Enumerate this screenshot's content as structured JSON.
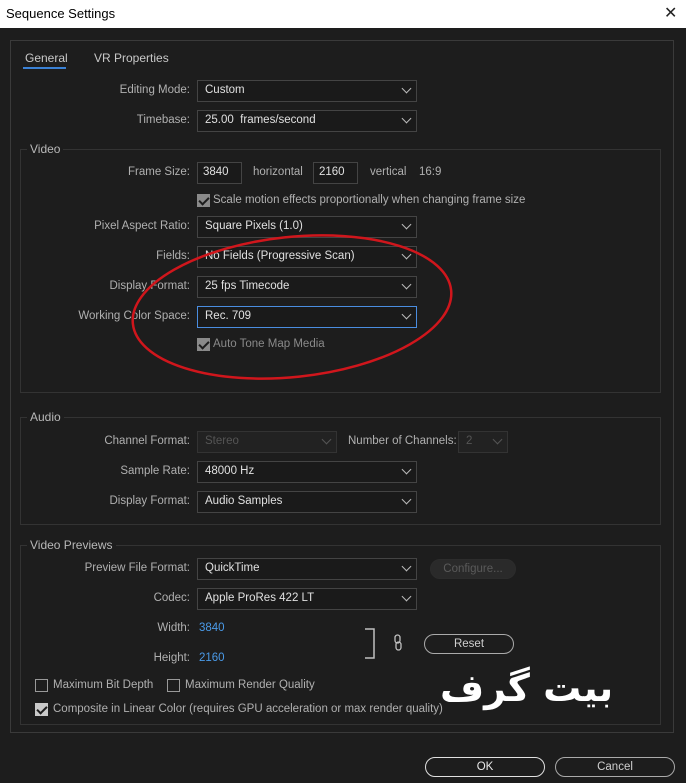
{
  "window": {
    "title": "Sequence Settings",
    "close_glyph": "✕"
  },
  "tabs": [
    "General",
    "VR Properties"
  ],
  "general": {
    "editing_mode": {
      "label": "Editing Mode:",
      "value": "Custom"
    },
    "timebase": {
      "label": "Timebase:",
      "value": "25.00  frames/second"
    }
  },
  "video": {
    "title": "Video",
    "frame_size_label": "Frame Size:",
    "width": "3840",
    "horizontal_label": "horizontal",
    "height": "2160",
    "vertical_label": "vertical",
    "aspect": "16:9",
    "scale_motion_label": "Scale motion effects proportionally when changing frame size",
    "pixel_aspect": {
      "label": "Pixel Aspect Ratio:",
      "value": "Square Pixels (1.0)"
    },
    "fields": {
      "label": "Fields:",
      "value": "No Fields (Progressive Scan)"
    },
    "display_format": {
      "label": "Display Format:",
      "value": "25 fps Timecode"
    },
    "color_space": {
      "label": "Working Color Space:",
      "value": "Rec. 709"
    },
    "auto_tone_map_label": "Auto Tone Map Media"
  },
  "audio": {
    "title": "Audio",
    "channel_format": {
      "label": "Channel Format:",
      "value": "Stereo"
    },
    "num_channels": {
      "label": "Number of Channels:",
      "value": "2"
    },
    "sample_rate": {
      "label": "Sample Rate:",
      "value": "48000 Hz"
    },
    "display_format": {
      "label": "Display Format:",
      "value": "Audio Samples"
    }
  },
  "previews": {
    "title": "Video Previews",
    "file_format": {
      "label": "Preview File Format:",
      "value": "QuickTime"
    },
    "configure_label": "Configure...",
    "codec": {
      "label": "Codec:",
      "value": "Apple ProRes 422 LT"
    },
    "width_label": "Width:",
    "width_value": "3840",
    "height_label": "Height:",
    "height_value": "2160",
    "reset_label": "Reset"
  },
  "options": {
    "max_bit_depth": "Maximum Bit Depth",
    "max_render_quality": "Maximum Render Quality",
    "linear_color": "Composite in Linear Color (requires GPU acceleration or max render quality)"
  },
  "watermark": "بیت گرف",
  "footer": {
    "ok": "OK",
    "cancel": "Cancel"
  },
  "colors": {
    "accent": "#3b82d6",
    "link_value": "#4a9ae8",
    "annotation": "#d0161c"
  }
}
